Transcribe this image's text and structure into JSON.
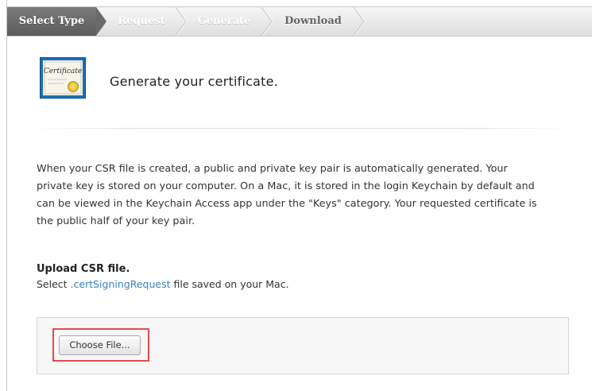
{
  "breadcrumb": {
    "steps": [
      {
        "label": "Select Type",
        "state": "active"
      },
      {
        "label": "Request",
        "state": "upcoming"
      },
      {
        "label": "Generate",
        "state": "upcoming"
      },
      {
        "label": "Download",
        "state": "upcoming"
      }
    ]
  },
  "header": {
    "icon": "certificate-icon",
    "icon_text": "Certificate",
    "title": "Generate your certificate."
  },
  "body": {
    "paragraph": "When your CSR file is created, a public and private key pair is automatically generated. Your private key is stored on your computer. On a Mac, it is stored in the login Keychain by default and can be viewed in the Keychain Access app under the \"Keys\" category. Your requested certificate is the public half of your key pair."
  },
  "upload": {
    "title": "Upload CSR file.",
    "sub_prefix": "Select ",
    "sub_link": ".certSigningRequest",
    "sub_suffix": " file saved on your Mac.",
    "choose_label": "Choose File..."
  },
  "colors": {
    "active_step": "#6a6a6a",
    "link": "#3a7fbf",
    "highlight": "#e34b4b"
  }
}
